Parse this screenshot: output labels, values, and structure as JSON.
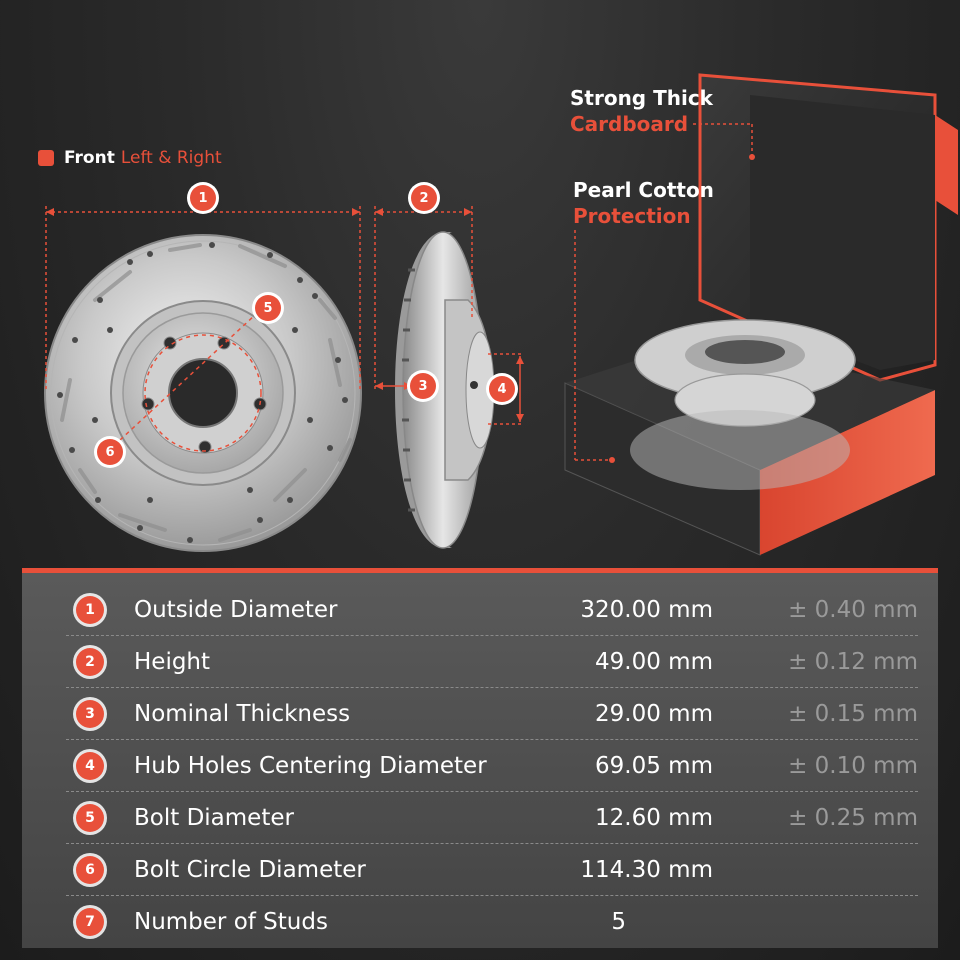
{
  "front": {
    "title": "Front",
    "sides": "Left & Right"
  },
  "package": {
    "cardboard_line1": "Strong Thick",
    "cardboard_line2": "Cardboard",
    "cotton_line1": "Pearl Cotton",
    "cotton_line2": "Protection"
  },
  "callouts": [
    "1",
    "2",
    "3",
    "4",
    "5",
    "6"
  ],
  "specs": [
    {
      "num": "1",
      "name": "Outside Diameter",
      "value": "320.00 mm",
      "tolerance": "± 0.40 mm"
    },
    {
      "num": "2",
      "name": "Height",
      "value": "49.00 mm",
      "tolerance": "± 0.12 mm"
    },
    {
      "num": "3",
      "name": "Nominal Thickness",
      "value": "29.00 mm",
      "tolerance": "± 0.15 mm"
    },
    {
      "num": "4",
      "name": "Hub Holes Centering Diameter",
      "value": "69.05 mm",
      "tolerance": "± 0.10 mm"
    },
    {
      "num": "5",
      "name": "Bolt Diameter",
      "value": "12.60 mm",
      "tolerance": "± 0.25 mm"
    },
    {
      "num": "6",
      "name": "Bolt Circle Diameter",
      "value": "114.30 mm",
      "tolerance": ""
    },
    {
      "num": "7",
      "name": "Number of Studs",
      "value": "5",
      "tolerance": ""
    }
  ],
  "colors": {
    "accent": "#e8503a",
    "panel": "#4e4e4e",
    "background": "#262626"
  }
}
